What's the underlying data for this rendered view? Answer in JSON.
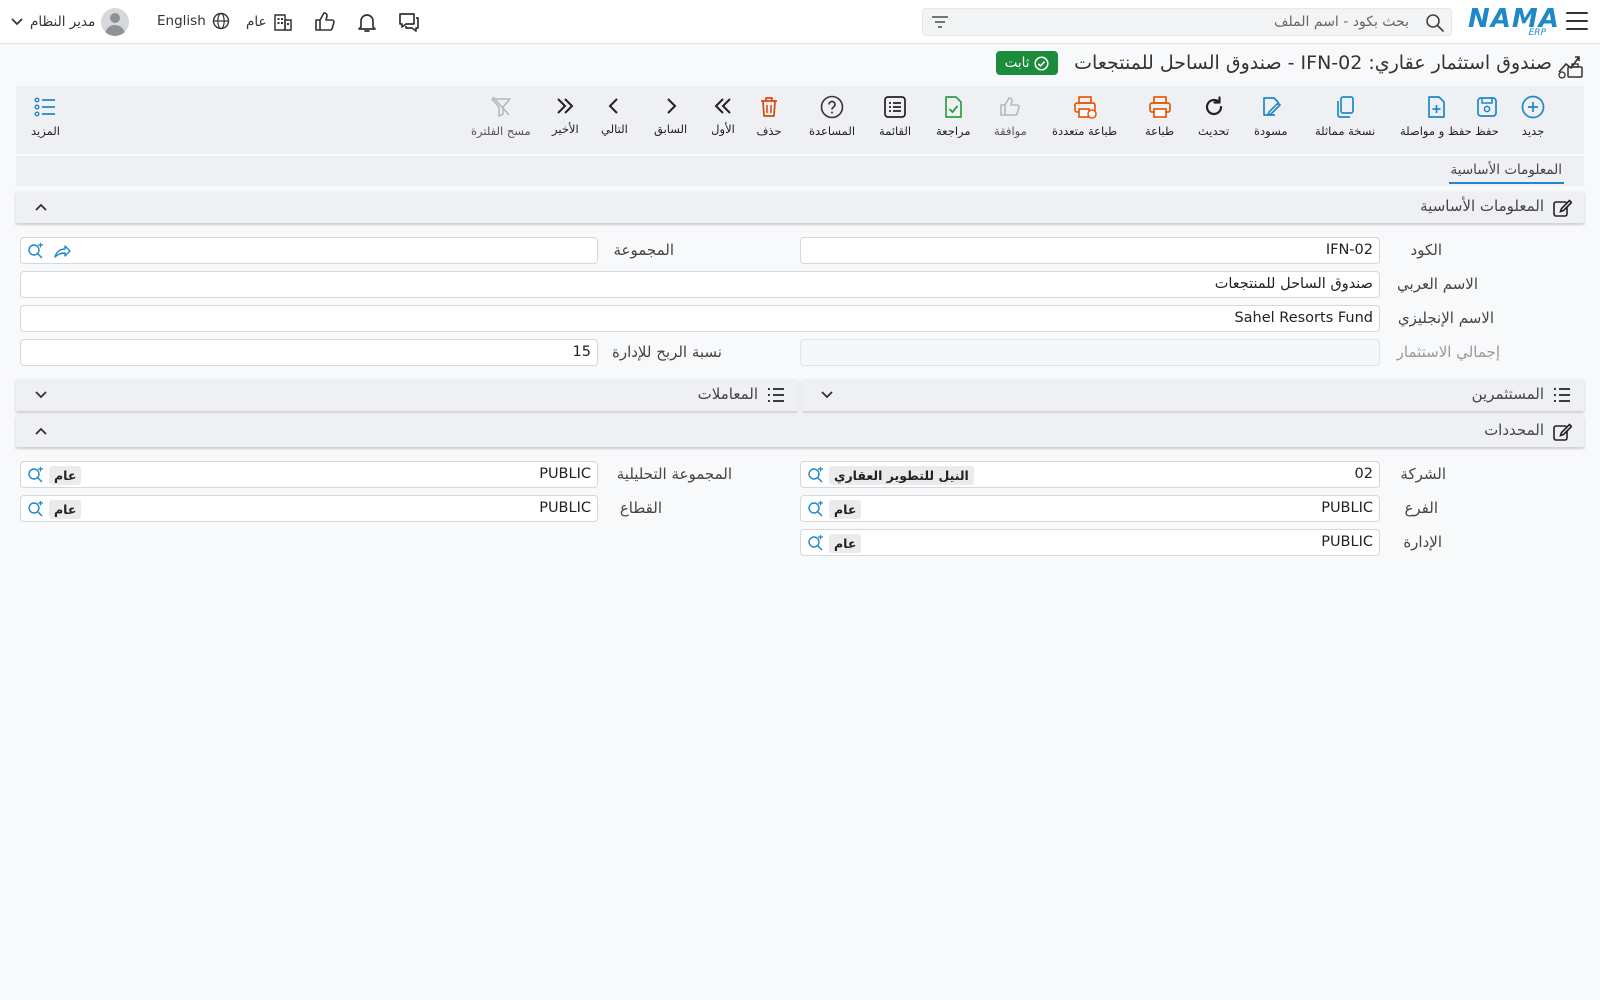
{
  "topbar": {
    "logo_main": "NAMA",
    "logo_sub": "ERP",
    "search_placeholder": "بحث بكود - اسم الملف",
    "language": "English",
    "public_label": "عام",
    "user_name": "مدير النظام"
  },
  "page": {
    "title": "صندوق استثمار عقاري: IFN-02 - صندوق الساحل للمنتجعات",
    "status_badge": "ثابت"
  },
  "toolbar": {
    "new": "جديد",
    "save": "حفظ",
    "save_continue": "حفظ و مواصلة",
    "duplicate": "نسخة مماثلة",
    "draft": "مسودة",
    "refresh": "تحديث",
    "print": "طباعة",
    "multi_print": "طباعة متعددة",
    "approve": "موافقة",
    "review": "مراجعة",
    "list": "القائمة",
    "help": "المساعدة",
    "delete": "حذف",
    "first": "الأول",
    "previous": "السابق",
    "next": "التالي",
    "last": "الأخير",
    "clear_filter": "مسح الفلترة",
    "more": "المزيد"
  },
  "tabs": {
    "basic_info": "المعلومات الأساسية"
  },
  "basic_section": {
    "title": "المعلومات الأساسية",
    "code_label": "الكود",
    "code_value": "IFN-02",
    "group_label": "المجموعة",
    "group_value": "",
    "arabic_name_label": "الاسم العربي",
    "arabic_name_value": "صندوق الساحل للمنتجعات",
    "english_name_label": "الاسم الإنجليزي",
    "english_name_value": "Sahel Resorts Fund",
    "total_investment_label": "إجمالي الاستثمار",
    "total_investment_value": "",
    "mgmt_profit_label": "نسبة الربح للإدارة",
    "mgmt_profit_value": "15"
  },
  "collapsed_sections": {
    "investors": "المستثمرين",
    "transactions": "المعاملات"
  },
  "dimensions_section": {
    "title": "المحددات",
    "company_label": "الشركة",
    "company_code": "02",
    "company_name": "النيل للتطوير العقاري",
    "branch_label": "الفرع",
    "branch_code": "PUBLIC",
    "branch_name": "عام",
    "department_label": "الإدارة",
    "department_code": "PUBLIC",
    "department_name": "عام",
    "analytic_group_label": "المجموعة التحليلية",
    "analytic_group_code": "PUBLIC",
    "analytic_group_name": "عام",
    "sector_label": "القطاع",
    "sector_code": "PUBLIC",
    "sector_name": "عام"
  },
  "colors": {
    "brand": "#1e88c8",
    "badge_green": "#1c8c3c",
    "orange": "#e8590c",
    "red": "#d9480f",
    "green": "#2f9e44"
  }
}
